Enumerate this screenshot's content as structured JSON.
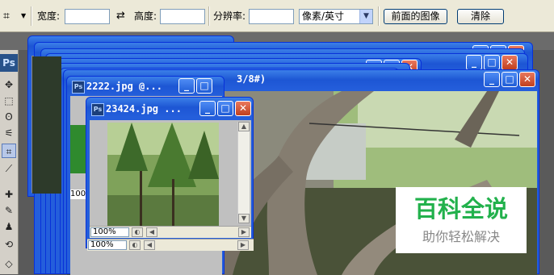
{
  "options_bar": {
    "width_label": "宽度:",
    "height_label": "高度:",
    "resolution_label": "分辨率:",
    "unit_select": "像素/英寸",
    "front_image_button": "前面的图像",
    "clear_button": "清除"
  },
  "toolbar": {
    "logo": "Ps"
  },
  "windows": {
    "large": {
      "title_fragment": "3/8#)"
    },
    "w2222": {
      "title": "2222.jpg @...",
      "zoom": "100"
    },
    "w23424": {
      "title": "23424.jpg ...",
      "zoom": "100%"
    },
    "bottom_zoom": "100%"
  },
  "watermark": {
    "title": "百科全说",
    "subtitle": "助你轻松解决"
  },
  "colors": {
    "title_bar": "#245edb",
    "close_button": "#c0401f",
    "watermark_green": "#22b14c"
  }
}
